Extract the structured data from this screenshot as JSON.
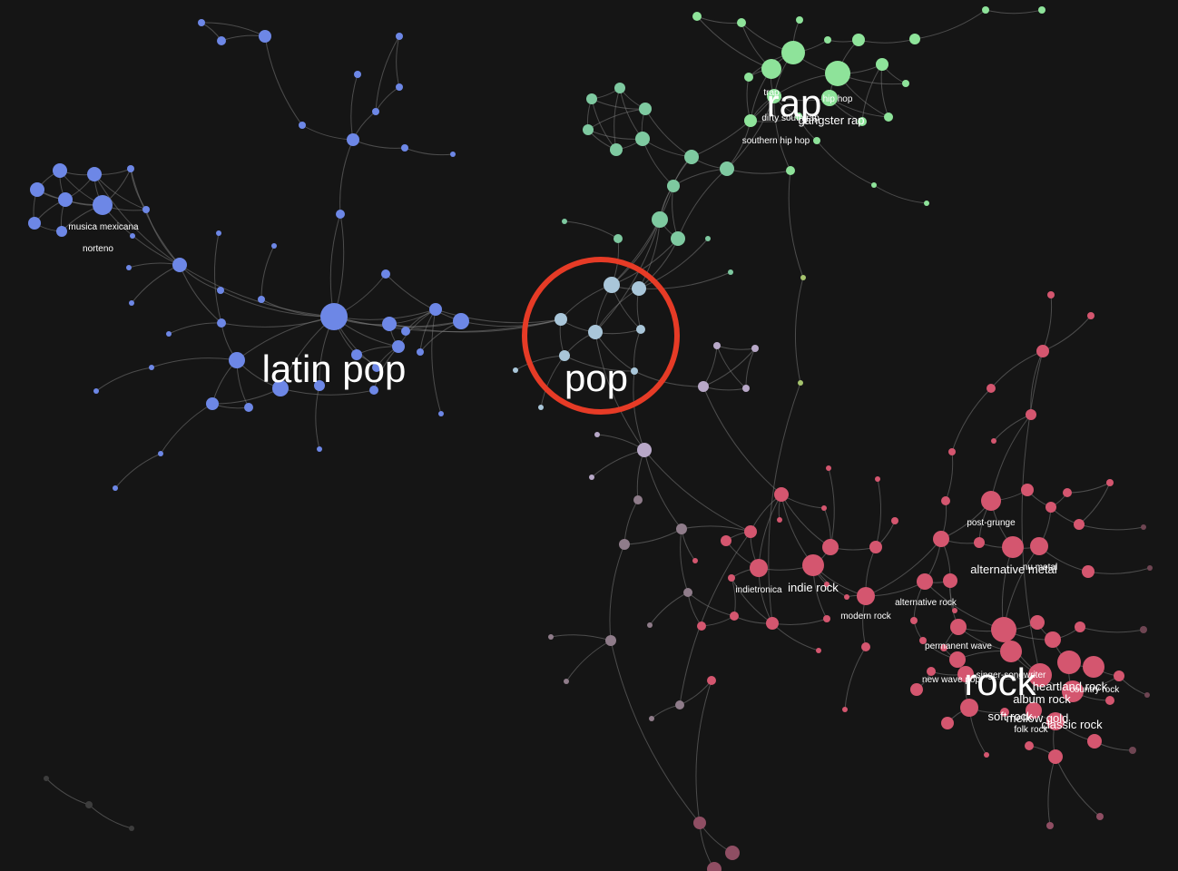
{
  "graph": {
    "background_color": "#151515",
    "edge_color": "#7a7a7a",
    "highlight_color": "#e63b26",
    "highlighted_cluster": "pop",
    "clusters": [
      {
        "key": "latin",
        "name": "latin pop",
        "color": "#6d87e6"
      },
      {
        "key": "pop",
        "name": "pop",
        "color": "#a9c6d9"
      },
      {
        "key": "rap",
        "name": "rap",
        "color": "#8ee39a"
      },
      {
        "key": "rock",
        "name": "rock",
        "color": "#d4566f"
      }
    ],
    "genre_labels": [
      "musica mexicana",
      "norteno",
      "trap",
      "hip hop",
      "dirty south rap",
      "gangster rap",
      "southern hip hop",
      "post-grunge",
      "alternative metal",
      "nu metal",
      "indietronica",
      "indie rock",
      "alternative rock",
      "modern rock",
      "permanent wave",
      "singer-songwriter",
      "new wave pop",
      "heartland rock",
      "country rock",
      "album rock",
      "soft rock",
      "mellow gold",
      "folk rock",
      "classic rock"
    ]
  }
}
